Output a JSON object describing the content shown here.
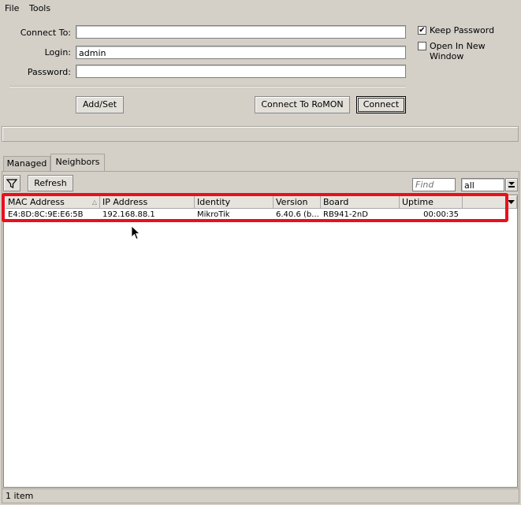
{
  "menu": {
    "file": "File",
    "tools": "Tools"
  },
  "connect": {
    "connect_to_label": "Connect To:",
    "connect_to_value": "",
    "login_label": "Login:",
    "login_value": "admin",
    "password_label": "Password:",
    "password_value": "",
    "keep_password_label": "Keep Password",
    "keep_password_checked": "✔",
    "open_new_window_label": "Open In New Window",
    "addset_button": "Add/Set",
    "romon_button": "Connect To RoMON",
    "connect_button": "Connect"
  },
  "tabs": {
    "managed": "Managed",
    "neighbors": "Neighbors"
  },
  "toolbar": {
    "filter_icon": "filter-icon",
    "refresh_button": "Refresh",
    "find_placeholder": "Find",
    "filter_select_value": "all"
  },
  "table": {
    "columns": [
      "MAC Address",
      "IP Address",
      "Identity",
      "Version",
      "Board",
      "Uptime"
    ],
    "rows": [
      {
        "mac": "E4:8D:8C:9E:E6:5B",
        "ip": "192.168.88.1",
        "identity": "MikroTik",
        "version": "6.40.6 (b...",
        "board": "RB941-2nD",
        "uptime": "00:00:35"
      }
    ]
  },
  "status": {
    "count": "1 item"
  },
  "colors": {
    "highlight": "#e8101c",
    "window_bg": "#d4d0c8"
  }
}
